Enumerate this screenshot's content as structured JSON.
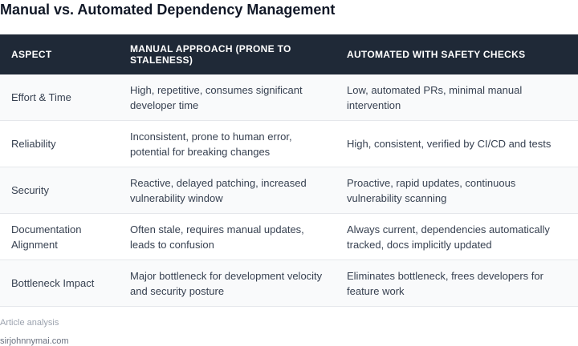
{
  "title": "Manual vs. Automated Dependency Management",
  "table": {
    "headers": [
      "ASPECT",
      "MANUAL APPROACH (PRONE TO STALENESS)",
      "AUTOMATED WITH SAFETY CHECKS"
    ],
    "rows": [
      [
        "Effort & Time",
        "High, repetitive, consumes significant developer time",
        "Low, automated PRs, minimal manual intervention"
      ],
      [
        "Reliability",
        "Inconsistent, prone to human error, potential for breaking changes",
        "High, consistent, verified by CI/CD and tests"
      ],
      [
        "Security",
        "Reactive, delayed patching, increased vulnerability window",
        "Proactive, rapid updates, continuous vulnerability scanning"
      ],
      [
        "Documentation Alignment",
        "Often stale, requires manual updates, leads to confusion",
        "Always current, dependencies automatically tracked, docs implicitly updated"
      ],
      [
        "Bottleneck Impact",
        "Major bottleneck for development velocity and security posture",
        "Eliminates bottleneck, frees developers for feature work"
      ]
    ]
  },
  "footer": {
    "note": "Article analysis",
    "site": "sirjohnnymai.com"
  }
}
